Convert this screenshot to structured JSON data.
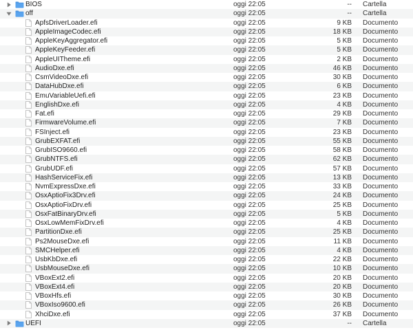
{
  "colors": {
    "folder": "#5aa4ee",
    "row_alt": "#f4f5f5",
    "disclosure": "#7d7d7d"
  },
  "rows": [
    {
      "name": "BIOS",
      "date": "oggi 22:05",
      "size": "--",
      "kind": "Cartella",
      "type": "folder",
      "depth": 0,
      "expanded": false
    },
    {
      "name": "off",
      "date": "oggi 22:05",
      "size": "--",
      "kind": "Cartella",
      "type": "folder",
      "depth": 0,
      "expanded": true
    },
    {
      "name": "ApfsDriverLoader.efi",
      "date": "oggi 22:05",
      "size": "9 KB",
      "kind": "Documento",
      "type": "file",
      "depth": 1
    },
    {
      "name": "AppleImageCodec.efi",
      "date": "oggi 22:05",
      "size": "18 KB",
      "kind": "Documento",
      "type": "file",
      "depth": 1
    },
    {
      "name": "AppleKeyAggregator.efi",
      "date": "oggi 22:05",
      "size": "5 KB",
      "kind": "Documento",
      "type": "file",
      "depth": 1
    },
    {
      "name": "AppleKeyFeeder.efi",
      "date": "oggi 22:05",
      "size": "5 KB",
      "kind": "Documento",
      "type": "file",
      "depth": 1
    },
    {
      "name": "AppleUITheme.efi",
      "date": "oggi 22:05",
      "size": "2 KB",
      "kind": "Documento",
      "type": "file",
      "depth": 1
    },
    {
      "name": "AudioDxe.efi",
      "date": "oggi 22:05",
      "size": "46 KB",
      "kind": "Documento",
      "type": "file",
      "depth": 1
    },
    {
      "name": "CsmVideoDxe.efi",
      "date": "oggi 22:05",
      "size": "30 KB",
      "kind": "Documento",
      "type": "file",
      "depth": 1
    },
    {
      "name": "DataHubDxe.efi",
      "date": "oggi 22:05",
      "size": "6 KB",
      "kind": "Documento",
      "type": "file",
      "depth": 1
    },
    {
      "name": "EmuVariableUefi.efi",
      "date": "oggi 22:05",
      "size": "23 KB",
      "kind": "Documento",
      "type": "file",
      "depth": 1
    },
    {
      "name": "EnglishDxe.efi",
      "date": "oggi 22:05",
      "size": "4 KB",
      "kind": "Documento",
      "type": "file",
      "depth": 1
    },
    {
      "name": "Fat.efi",
      "date": "oggi 22:05",
      "size": "29 KB",
      "kind": "Documento",
      "type": "file",
      "depth": 1
    },
    {
      "name": "FirmwareVolume.efi",
      "date": "oggi 22:05",
      "size": "7 KB",
      "kind": "Documento",
      "type": "file",
      "depth": 1
    },
    {
      "name": "FSInject.efi",
      "date": "oggi 22:05",
      "size": "23 KB",
      "kind": "Documento",
      "type": "file",
      "depth": 1
    },
    {
      "name": "GrubEXFAT.efi",
      "date": "oggi 22:05",
      "size": "55 KB",
      "kind": "Documento",
      "type": "file",
      "depth": 1
    },
    {
      "name": "GrubISO9660.efi",
      "date": "oggi 22:05",
      "size": "58 KB",
      "kind": "Documento",
      "type": "file",
      "depth": 1
    },
    {
      "name": "GrubNTFS.efi",
      "date": "oggi 22:05",
      "size": "62 KB",
      "kind": "Documento",
      "type": "file",
      "depth": 1
    },
    {
      "name": "GrubUDF.efi",
      "date": "oggi 22:05",
      "size": "57 KB",
      "kind": "Documento",
      "type": "file",
      "depth": 1
    },
    {
      "name": "HashServiceFix.efi",
      "date": "oggi 22:05",
      "size": "13 KB",
      "kind": "Documento",
      "type": "file",
      "depth": 1
    },
    {
      "name": "NvmExpressDxe.efi",
      "date": "oggi 22:05",
      "size": "33 KB",
      "kind": "Documento",
      "type": "file",
      "depth": 1
    },
    {
      "name": "OsxAptioFix3Drv.efi",
      "date": "oggi 22:05",
      "size": "24 KB",
      "kind": "Documento",
      "type": "file",
      "depth": 1
    },
    {
      "name": "OsxAptioFixDrv.efi",
      "date": "oggi 22:05",
      "size": "25 KB",
      "kind": "Documento",
      "type": "file",
      "depth": 1
    },
    {
      "name": "OsxFatBinaryDrv.efi",
      "date": "oggi 22:05",
      "size": "5 KB",
      "kind": "Documento",
      "type": "file",
      "depth": 1
    },
    {
      "name": "OsxLowMemFixDrv.efi",
      "date": "oggi 22:05",
      "size": "4 KB",
      "kind": "Documento",
      "type": "file",
      "depth": 1
    },
    {
      "name": "PartitionDxe.efi",
      "date": "oggi 22:05",
      "size": "25 KB",
      "kind": "Documento",
      "type": "file",
      "depth": 1
    },
    {
      "name": "Ps2MouseDxe.efi",
      "date": "oggi 22:05",
      "size": "11 KB",
      "kind": "Documento",
      "type": "file",
      "depth": 1
    },
    {
      "name": "SMCHelper.efi",
      "date": "oggi 22:05",
      "size": "4 KB",
      "kind": "Documento",
      "type": "file",
      "depth": 1
    },
    {
      "name": "UsbKbDxe.efi",
      "date": "oggi 22:05",
      "size": "22 KB",
      "kind": "Documento",
      "type": "file",
      "depth": 1
    },
    {
      "name": "UsbMouseDxe.efi",
      "date": "oggi 22:05",
      "size": "10 KB",
      "kind": "Documento",
      "type": "file",
      "depth": 1
    },
    {
      "name": "VBoxExt2.efi",
      "date": "oggi 22:05",
      "size": "20 KB",
      "kind": "Documento",
      "type": "file",
      "depth": 1
    },
    {
      "name": "VBoxExt4.efi",
      "date": "oggi 22:05",
      "size": "20 KB",
      "kind": "Documento",
      "type": "file",
      "depth": 1
    },
    {
      "name": "VBoxHfs.efi",
      "date": "oggi 22:05",
      "size": "30 KB",
      "kind": "Documento",
      "type": "file",
      "depth": 1
    },
    {
      "name": "VBoxIso9600.efi",
      "date": "oggi 22:05",
      "size": "26 KB",
      "kind": "Documento",
      "type": "file",
      "depth": 1
    },
    {
      "name": "XhciDxe.efi",
      "date": "oggi 22:05",
      "size": "37 KB",
      "kind": "Documento",
      "type": "file",
      "depth": 1
    },
    {
      "name": "UEFI",
      "date": "oggi 22:05",
      "size": "--",
      "kind": "Cartella",
      "type": "folder",
      "depth": 0,
      "expanded": false
    }
  ]
}
